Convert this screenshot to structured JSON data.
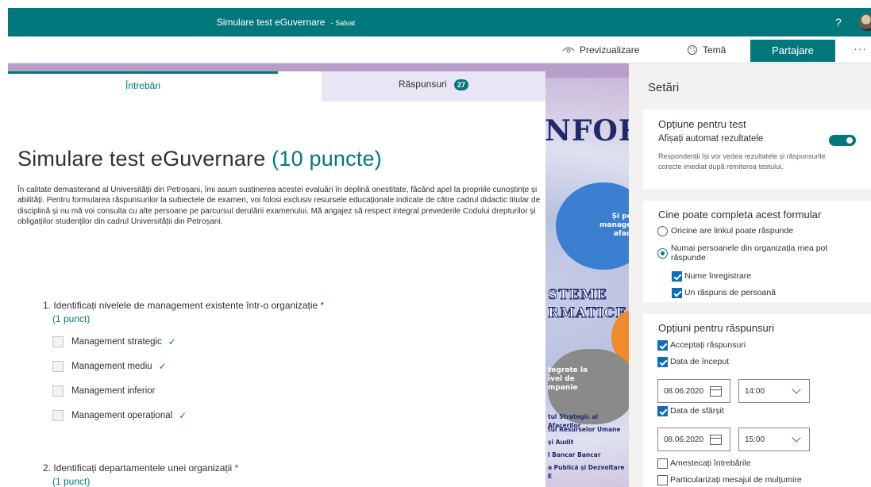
{
  "topbar": {
    "title": "Simulare test eGuvernare",
    "saved": "- Salvat",
    "help": "?"
  },
  "commands": {
    "preview": "Previzualizare",
    "theme": "Temă",
    "share": "Partajare",
    "more": "···"
  },
  "background": {
    "inform": "NFORM",
    "blob1_text": "Și pentr\nmanageme\nafaceril",
    "steme": "STEME",
    "rmatice": "RMATICE",
    "m": "m",
    "integrate": "tegrate la\nivel de\nmpanie",
    "list": [
      "tul Strategic al Afacerilor",
      "tul Resurselor Umane",
      "și Audit",
      "l Bancar Bancar",
      "a Publică și Dezvoltare E"
    ]
  },
  "tabs": {
    "questions": "Întrebări",
    "responses": "Răspunsuri",
    "responses_count": "27"
  },
  "form": {
    "title": "Simulare test eGuvernare",
    "points": "(10 puncte)",
    "description": "În calitate demasterand al Universității din Petroșani, îmi asum susținerea acestei evaluări în deplină onestitate, făcând apel la propriile cunoștințe și abilități. Pentru formularea răspunsurilor la subiectele de examen, voi folosi exclusiv resursele educaționale indicate de către cadrul didactic titular de disciplină și nu mă voi consulta cu alte persoane pe parcursul derulării examenului. Mă angajez să respect integral prevederile Codului drepturilor și obligațiilor studenților din cadrul Universității din Petroșani."
  },
  "questions": [
    {
      "text": "1. Identificați nivelele de management existente într-o organizație",
      "required": "*",
      "points": "(1 punct)",
      "options": [
        {
          "label": "Management strategic",
          "correct": true
        },
        {
          "label": "Management mediu",
          "correct": true
        },
        {
          "label": "Management inferior",
          "correct": false
        },
        {
          "label": "Management operațional",
          "correct": true
        }
      ]
    },
    {
      "text": "2. Identificați departamentele unei organizații",
      "required": "*",
      "points": "(1 punct)"
    }
  ],
  "settings": {
    "title": "Setări",
    "test_options": {
      "title": "Opțiune pentru test",
      "auto_show": "Afișați automat rezultatele",
      "auto_show_on": true,
      "help": "Respondenții își vor vedea rezultatele și răspunsurile corecte imediat după remiterea testului."
    },
    "who": {
      "title": "Cine poate completa acest formular",
      "anyone": "Oricine are linkul poate răspunde",
      "org_only": "Numai persoanele din organizația mea pot răspunde",
      "record_name": "Nume înregistrare",
      "one_response": "Un răspuns de persoană"
    },
    "response_options": {
      "title": "Opțiuni pentru răspunsuri",
      "accept": "Acceptați răspunsuri",
      "start_date": "Data de început",
      "start_date_value": "08.06.2020",
      "start_time_value": "14:00",
      "end_date": "Data de sfârșit",
      "end_date_value": "08.06.2020",
      "end_time_value": "15:00",
      "shuffle": "Amestecați întrebările",
      "thanks": "Particularizați mesajul de mulțumire"
    }
  },
  "colors": {
    "accent": "#03787c",
    "required": "#a4262c",
    "checkbox": "#0f6cbd"
  }
}
